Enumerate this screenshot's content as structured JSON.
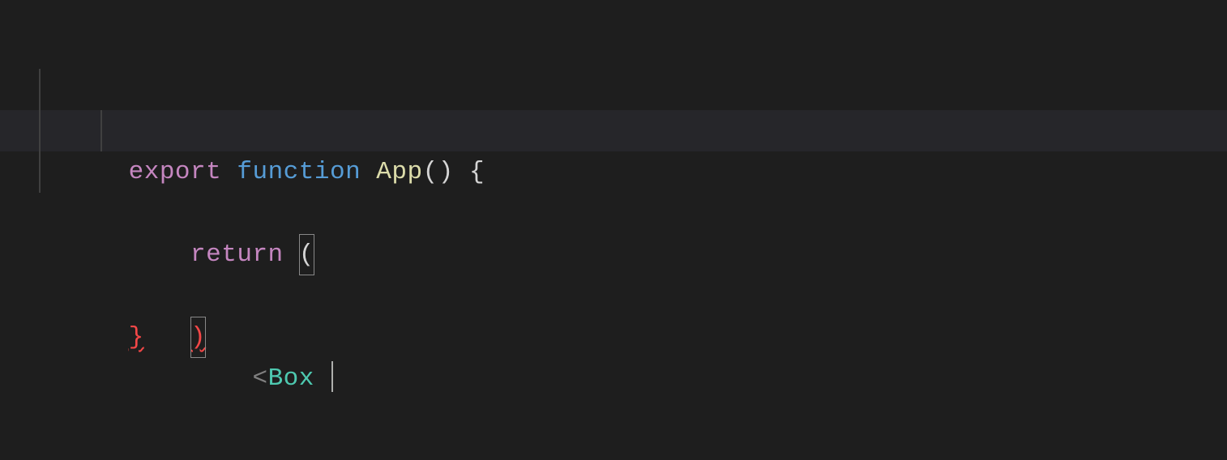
{
  "code": {
    "line1": {
      "export": "export",
      "space1": " ",
      "function": "function",
      "space2": " ",
      "fn_name": "App",
      "parens": "()",
      "space3": " ",
      "brace_open": "{"
    },
    "line2": {
      "indent": "    ",
      "return": "return",
      "space": " ",
      "paren_open": "("
    },
    "line3": {
      "indent": "        ",
      "lt": "<",
      "component": "Box",
      "space": " "
    },
    "line4": {
      "indent": "    ",
      "paren_close": ")"
    },
    "line5": {
      "brace_close": "}"
    }
  }
}
